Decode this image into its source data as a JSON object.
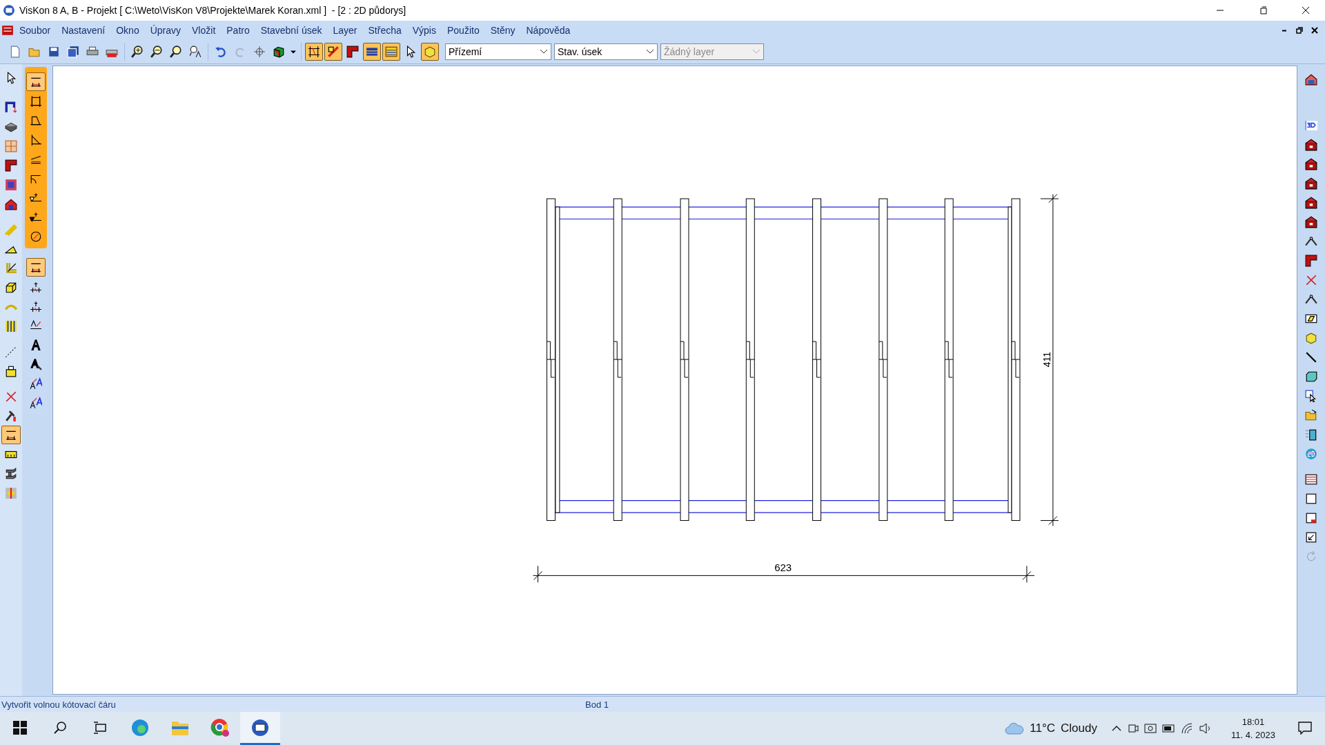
{
  "title_bar": {
    "title": "VisKon 8 A, B - Projekt [ C:\\Weto\\VisKon V8\\Projekte\\Marek Koran.xml ]  - [2 : 2D půdorys]"
  },
  "menu_bar": {
    "items": [
      "Soubor",
      "Nastavení",
      "Okno",
      "Úpravy",
      "Vložit",
      "Patro",
      "Stavební úsek",
      "Layer",
      "Střecha",
      "Výpis",
      "Použito",
      "Stěny",
      "Nápověda"
    ]
  },
  "toolbar": {
    "buttons": [
      {
        "pressed": false
      },
      {
        "pressed": false
      },
      {
        "pressed": false
      },
      {
        "pressed": false
      },
      {
        "pressed": false
      },
      {
        "pressed": false
      },
      {
        "pressed": false
      },
      {
        "pressed": false
      },
      {
        "pressed": false
      },
      {
        "pressed": false
      },
      {
        "pressed": false
      },
      {
        "pressed": false
      },
      {
        "pressed": false
      },
      {
        "pressed": false
      },
      {
        "pressed": false
      },
      {
        "pressed": true
      },
      {
        "pressed": true
      },
      {
        "pressed": false
      },
      {
        "pressed": true
      },
      {
        "pressed": true
      },
      {
        "pressed": false
      },
      {
        "pressed": true
      }
    ],
    "dropdowns": [
      {
        "value": "Přízemí",
        "disabled": false
      },
      {
        "value": "Stav. úsek",
        "disabled": false
      },
      {
        "value": "Žádný layer",
        "disabled": true
      }
    ]
  },
  "left_toolbar": {
    "buttons": [
      {
        "pressed": false
      },
      {
        "pressed": false
      },
      {
        "pressed": false
      },
      {
        "pressed": false
      },
      {
        "pressed": false
      },
      {
        "pressed": false
      },
      {
        "pressed": false
      },
      {
        "pressed": false
      },
      {
        "pressed": false
      },
      {
        "pressed": false
      },
      {
        "pressed": false
      },
      {
        "pressed": false
      },
      {
        "pressed": false
      },
      {
        "pressed": false
      },
      {
        "pressed": false
      },
      {
        "pressed": false
      },
      {
        "pressed": false
      },
      {
        "pressed": true
      },
      {
        "pressed": false
      },
      {
        "pressed": false
      },
      {
        "pressed": false
      }
    ]
  },
  "dimension_toolbar": {
    "buttons": [
      {
        "selected": true
      },
      {
        "selected": false
      },
      {
        "selected": false
      },
      {
        "selected": false
      },
      {
        "selected": false
      },
      {
        "selected": false
      },
      {
        "selected": false
      },
      {
        "selected": false
      },
      {
        "selected": false
      }
    ]
  },
  "annotation_toolbar": {
    "buttons": [
      {
        "selected": true
      },
      {
        "selected": false
      },
      {
        "selected": false
      },
      {
        "selected": false
      },
      {
        "selected": false
      },
      {
        "selected": false
      },
      {
        "selected": false
      },
      {
        "selected": false
      }
    ]
  },
  "drawing": {
    "height_dimension": "411",
    "width_dimension": "623"
  },
  "status_bar": {
    "message": "Vytvořit volnou kótovací čáru",
    "point": "Bod 1"
  },
  "taskbar": {
    "apps": [
      {
        "selected": false
      },
      {
        "selected": false
      },
      {
        "selected": false
      },
      {
        "selected": true
      }
    ],
    "temperature": "11°C",
    "condition": "Cloudy",
    "time": "18:01",
    "date": "11. 4. 2023"
  }
}
